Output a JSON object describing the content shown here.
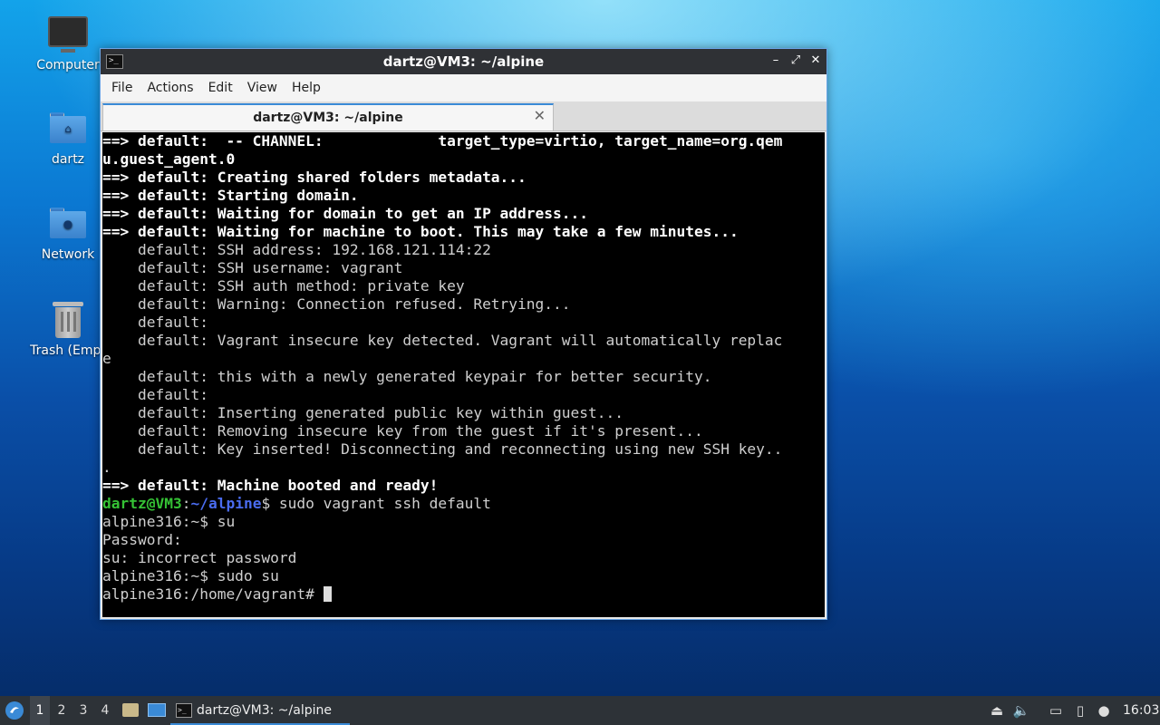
{
  "desktop": {
    "icons": [
      {
        "label": "Computer",
        "icon": "computer-icon"
      },
      {
        "label": "dartz",
        "icon": "home-folder-icon"
      },
      {
        "label": "Network",
        "icon": "network-folder-icon"
      },
      {
        "label": "Trash (Empt",
        "icon": "trash-icon"
      }
    ]
  },
  "window": {
    "title": "dartz@VM3: ~/alpine",
    "controls": {
      "minimize": "–",
      "maximize": "⤢",
      "close": "✕"
    },
    "menu": [
      "File",
      "Actions",
      "Edit",
      "View",
      "Help"
    ],
    "tab": {
      "title": "dartz@VM3: ~/alpine",
      "close": "✕"
    }
  },
  "terminal": {
    "lines": [
      "==> default:  -- CHANNEL:             target_type=virtio, target_name=org.qem",
      "u.guest_agent.0",
      "==> default: Creating shared folders metadata...",
      "==> default: Starting domain.",
      "==> default: Waiting for domain to get an IP address...",
      "==> default: Waiting for machine to boot. This may take a few minutes...",
      "    default: SSH address: 192.168.121.114:22",
      "    default: SSH username: vagrant",
      "    default: SSH auth method: private key",
      "    default: Warning: Connection refused. Retrying...",
      "    default:",
      "    default: Vagrant insecure key detected. Vagrant will automatically replac",
      "e",
      "    default: this with a newly generated keypair for better security.",
      "    default:",
      "    default: Inserting generated public key within guest...",
      "    default: Removing insecure key from the guest if it's present...",
      "    default: Key inserted! Disconnecting and reconnecting using new SSH key..",
      ".",
      "==> default: Machine booted and ready!"
    ],
    "bold_line_indices": [
      0,
      1,
      2,
      3,
      4,
      5,
      19
    ],
    "prompt": {
      "user": "dartz@VM3",
      "sep": ":",
      "path": "~/alpine",
      "symbol": "$",
      "command": " sudo vagrant ssh default"
    },
    "after_lines": [
      "alpine316:~$ su",
      "Password:",
      "su: incorrect password",
      "alpine316:~$ sudo su"
    ],
    "last_prompt": "alpine316:/home/vagrant# "
  },
  "taskbar": {
    "workspaces": [
      "1",
      "2",
      "3",
      "4"
    ],
    "active_workspace": "1",
    "task_label": "dartz@VM3: ~/alpine",
    "clock": "16:03",
    "accent": "#3a8ad6"
  }
}
